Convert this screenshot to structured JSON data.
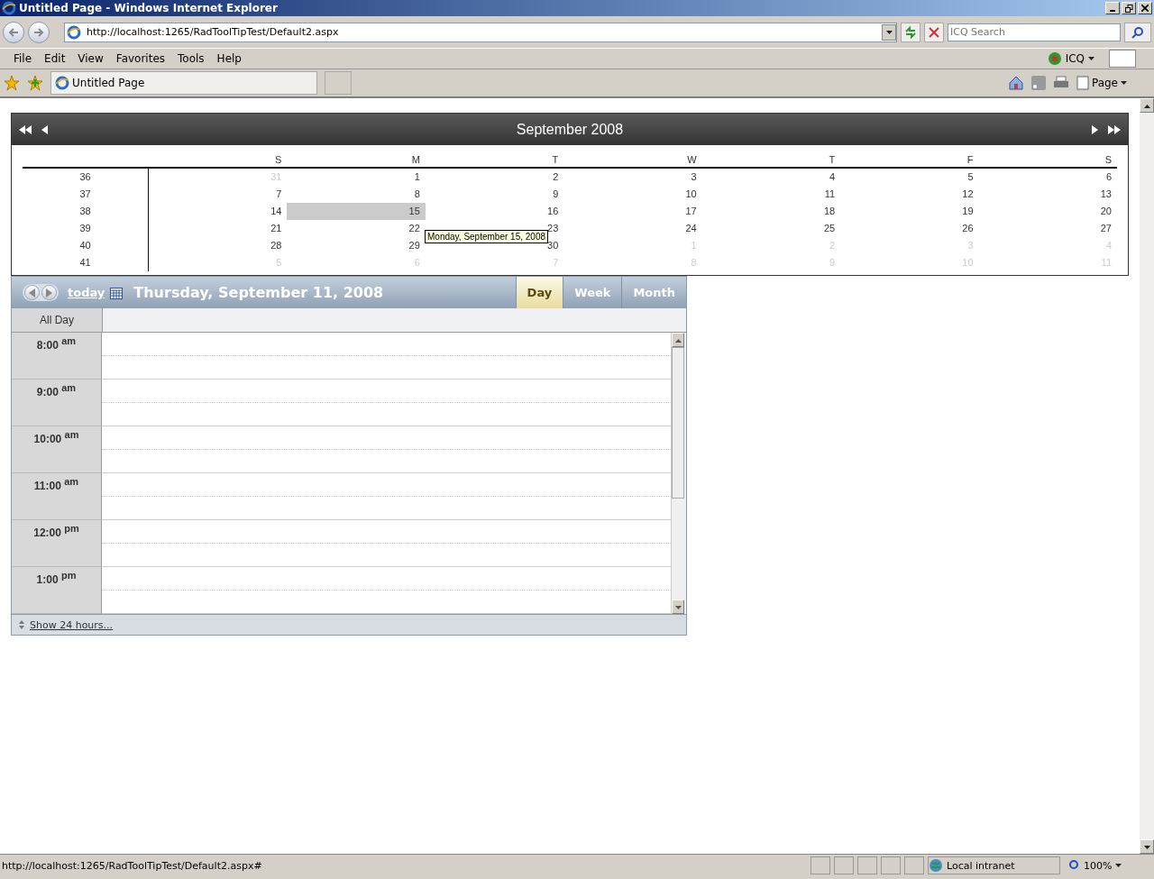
{
  "window": {
    "title": "Untitled Page - Windows Internet Explorer"
  },
  "address_bar": {
    "url": "http://localhost:1265/RadToolTipTest/Default2.aspx",
    "search_placeholder": "ICQ Search"
  },
  "menu": [
    "File",
    "Edit",
    "View",
    "Favorites",
    "Tools",
    "Help"
  ],
  "toolbar": {
    "icq_label": "ICQ",
    "page_label": "Page"
  },
  "tabs": [
    {
      "label": "Untitled Page",
      "selected": true
    }
  ],
  "calendar": {
    "title": "September 2008",
    "weekdays": [
      "S",
      "M",
      "T",
      "W",
      "T",
      "F",
      "S"
    ],
    "weeks": [
      {
        "number": "36",
        "days": [
          {
            "label": "31",
            "other": true,
            "selected": false
          },
          {
            "label": "1",
            "other": false,
            "selected": false
          },
          {
            "label": "2",
            "other": false,
            "selected": false
          },
          {
            "label": "3",
            "other": false,
            "selected": false
          },
          {
            "label": "4",
            "other": false,
            "selected": false
          },
          {
            "label": "5",
            "other": false,
            "selected": false
          },
          {
            "label": "6",
            "other": false,
            "selected": false
          }
        ]
      },
      {
        "number": "37",
        "days": [
          {
            "label": "7",
            "other": false,
            "selected": false
          },
          {
            "label": "8",
            "other": false,
            "selected": false
          },
          {
            "label": "9",
            "other": false,
            "selected": false
          },
          {
            "label": "10",
            "other": false,
            "selected": false
          },
          {
            "label": "11",
            "other": false,
            "selected": false
          },
          {
            "label": "12",
            "other": false,
            "selected": false
          },
          {
            "label": "13",
            "other": false,
            "selected": false
          }
        ]
      },
      {
        "number": "38",
        "days": [
          {
            "label": "14",
            "other": false,
            "selected": false
          },
          {
            "label": "15",
            "other": false,
            "selected": true
          },
          {
            "label": "16",
            "other": false,
            "selected": false
          },
          {
            "label": "17",
            "other": false,
            "selected": false
          },
          {
            "label": "18",
            "other": false,
            "selected": false
          },
          {
            "label": "19",
            "other": false,
            "selected": false
          },
          {
            "label": "20",
            "other": false,
            "selected": false
          }
        ]
      },
      {
        "number": "39",
        "days": [
          {
            "label": "21",
            "other": false,
            "selected": false
          },
          {
            "label": "22",
            "other": false,
            "selected": false
          },
          {
            "label": "23",
            "other": false,
            "selected": false
          },
          {
            "label": "24",
            "other": false,
            "selected": false
          },
          {
            "label": "25",
            "other": false,
            "selected": false
          },
          {
            "label": "26",
            "other": false,
            "selected": false
          },
          {
            "label": "27",
            "other": false,
            "selected": false
          }
        ]
      },
      {
        "number": "40",
        "days": [
          {
            "label": "28",
            "other": false,
            "selected": false
          },
          {
            "label": "29",
            "other": false,
            "selected": false
          },
          {
            "label": "30",
            "other": false,
            "selected": false
          },
          {
            "label": "1",
            "other": true,
            "selected": false
          },
          {
            "label": "2",
            "other": true,
            "selected": false
          },
          {
            "label": "3",
            "other": true,
            "selected": false
          },
          {
            "label": "4",
            "other": true,
            "selected": false
          }
        ]
      },
      {
        "number": "41",
        "days": [
          {
            "label": "5",
            "other": true,
            "selected": false
          },
          {
            "label": "6",
            "other": true,
            "selected": false
          },
          {
            "label": "7",
            "other": true,
            "selected": false
          },
          {
            "label": "8",
            "other": true,
            "selected": false
          },
          {
            "label": "9",
            "other": true,
            "selected": false
          },
          {
            "label": "10",
            "other": true,
            "selected": false
          },
          {
            "label": "11",
            "other": true,
            "selected": false
          }
        ]
      }
    ],
    "tooltip": "Monday, September 15, 2008"
  },
  "scheduler": {
    "today": "today",
    "date": "Thursday, September 11, 2008",
    "views": [
      {
        "label": "Day",
        "selected": true
      },
      {
        "label": "Week",
        "selected": false
      },
      {
        "label": "Month",
        "selected": false
      }
    ],
    "all_day": "All Day",
    "times": [
      "8:00 $^{am}$",
      "9:00 $^{am}$",
      "10:00 $^{am}$",
      "11:00 $^{am}$",
      "12:00 $^{pm}$",
      "1:00 $^{pm}$"
    ],
    "footer": "Show 24 hours..."
  },
  "status_bar": {
    "text": "http://localhost:1265/RadToolTipTest/Default2.aspx#",
    "zone": "Local intranet",
    "zoom": "100%"
  }
}
